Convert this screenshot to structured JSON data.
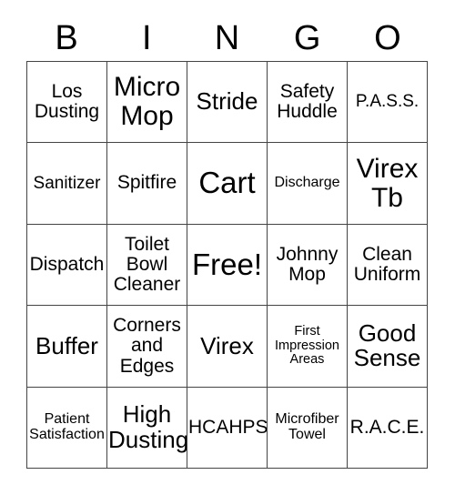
{
  "card": {
    "header_letters": [
      "B",
      "I",
      "N",
      "G",
      "O"
    ],
    "rows": [
      [
        {
          "text": "Los\nDusting",
          "size": "md"
        },
        {
          "text": "Micro\nMop",
          "size": "xl"
        },
        {
          "text": "Stride",
          "size": "lg"
        },
        {
          "text": "Safety\nHuddle",
          "size": "md"
        },
        {
          "text": "P.A.S.S.",
          "size": "sm"
        }
      ],
      [
        {
          "text": "Sanitizer",
          "size": "sm"
        },
        {
          "text": "Spitfire",
          "size": "md"
        },
        {
          "text": "Cart",
          "size": "xxl"
        },
        {
          "text": "Discharge",
          "size": "xs"
        },
        {
          "text": "Virex\nTb",
          "size": "xl"
        }
      ],
      [
        {
          "text": "Dispatch",
          "size": "md"
        },
        {
          "text": "Toilet\nBowl\nCleaner",
          "size": "md"
        },
        {
          "text": "Free!",
          "size": "xxl"
        },
        {
          "text": "Johnny\nMop",
          "size": "md"
        },
        {
          "text": "Clean\nUniform",
          "size": "md"
        }
      ],
      [
        {
          "text": "Buffer",
          "size": "lg"
        },
        {
          "text": "Corners\nand\nEdges",
          "size": "md"
        },
        {
          "text": "Virex",
          "size": "lg"
        },
        {
          "text": "First\nImpression\nAreas",
          "size": "xxs"
        },
        {
          "text": "Good\nSense",
          "size": "lg"
        }
      ],
      [
        {
          "text": "Patient\nSatisfaction",
          "size": "xs"
        },
        {
          "text": "High\nDusting",
          "size": "lg"
        },
        {
          "text": "HCAHPS",
          "size": "md"
        },
        {
          "text": "Microfiber\nTowel",
          "size": "xs"
        },
        {
          "text": "R.A.C.E.",
          "size": "md"
        }
      ]
    ]
  },
  "colors": {
    "background": "#ffffff",
    "text": "#000000",
    "grid_line": "#444444"
  }
}
